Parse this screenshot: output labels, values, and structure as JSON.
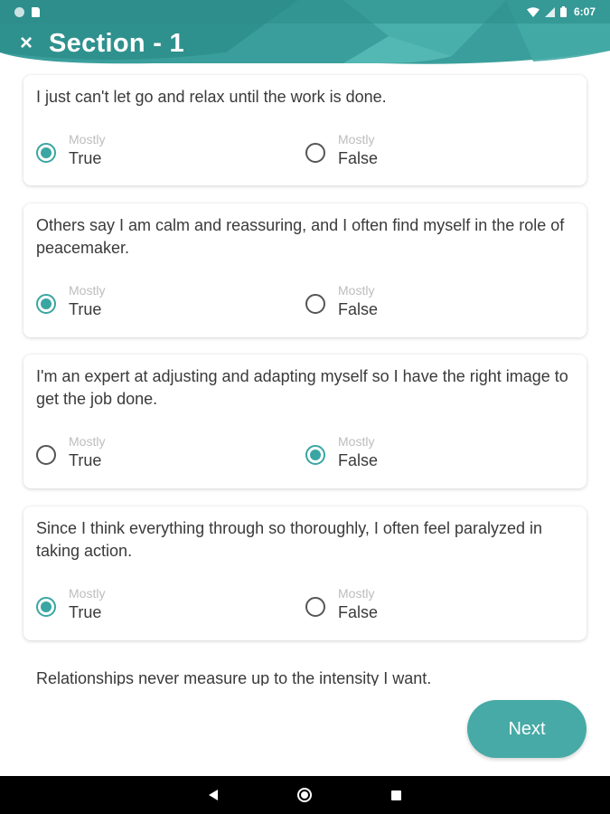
{
  "status_bar": {
    "time": "6:07",
    "icons": [
      "notification-dot-icon",
      "sd-card-icon",
      "wifi-icon",
      "signal-icon",
      "battery-icon"
    ]
  },
  "header": {
    "close_icon": "×",
    "title": "Section - 1"
  },
  "questions": [
    {
      "text": "I just can't let go and relax until the work is done.",
      "options": [
        {
          "qualifier": "Mostly",
          "label": "True",
          "selected": true
        },
        {
          "qualifier": "Mostly",
          "label": "False",
          "selected": false
        }
      ]
    },
    {
      "text": "Others say I am calm and reassuring, and I often find myself in the role of peacemaker.",
      "options": [
        {
          "qualifier": "Mostly",
          "label": "True",
          "selected": true
        },
        {
          "qualifier": "Mostly",
          "label": "False",
          "selected": false
        }
      ]
    },
    {
      "text": "I'm an expert at adjusting and adapting myself so I have the right image to get the job done.",
      "options": [
        {
          "qualifier": "Mostly",
          "label": "True",
          "selected": false
        },
        {
          "qualifier": "Mostly",
          "label": "False",
          "selected": true
        }
      ]
    },
    {
      "text": "Since I think everything through so thoroughly, I often feel paralyzed in taking action.",
      "options": [
        {
          "qualifier": "Mostly",
          "label": "True",
          "selected": true
        },
        {
          "qualifier": "Mostly",
          "label": "False",
          "selected": false
        }
      ]
    },
    {
      "text": "Relationships never measure up to the intensity I want."
    }
  ],
  "footer": {
    "next_label": "Next"
  },
  "colors": {
    "accent": "#3aa6a3",
    "header_dark": "#2c8d8a",
    "header_light": "#5ec2be",
    "button": "#47aaa6"
  }
}
